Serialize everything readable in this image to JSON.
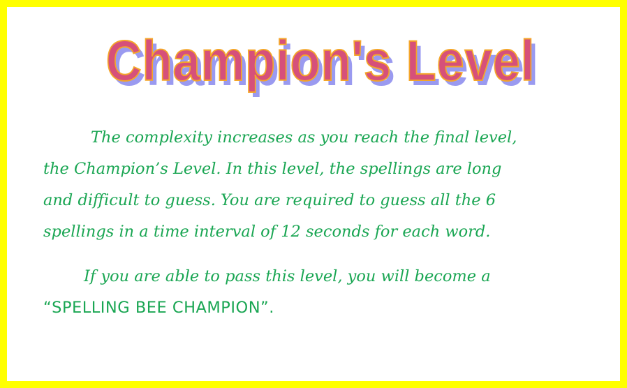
{
  "title": "Champion's Level",
  "paragraph1": {
    "lines": [
      "The complexity increases as you reach the final level,",
      "the Champion’s Level. In this level, the spellings are long",
      "and difficult to guess. You are required to guess all the 6",
      "spellings in a time interval of 12 seconds for each word."
    ]
  },
  "paragraph2": {
    "line1": "If you are able to pass this level, you will become a",
    "line2": "“SPELLING BEE CHAMPION”."
  },
  "colors": {
    "border": "#ffff00",
    "title_fill": "#d6507a",
    "title_outline": "#f4a62a",
    "title_shadow": "#9a9af0",
    "body_text": "#1aa653"
  }
}
